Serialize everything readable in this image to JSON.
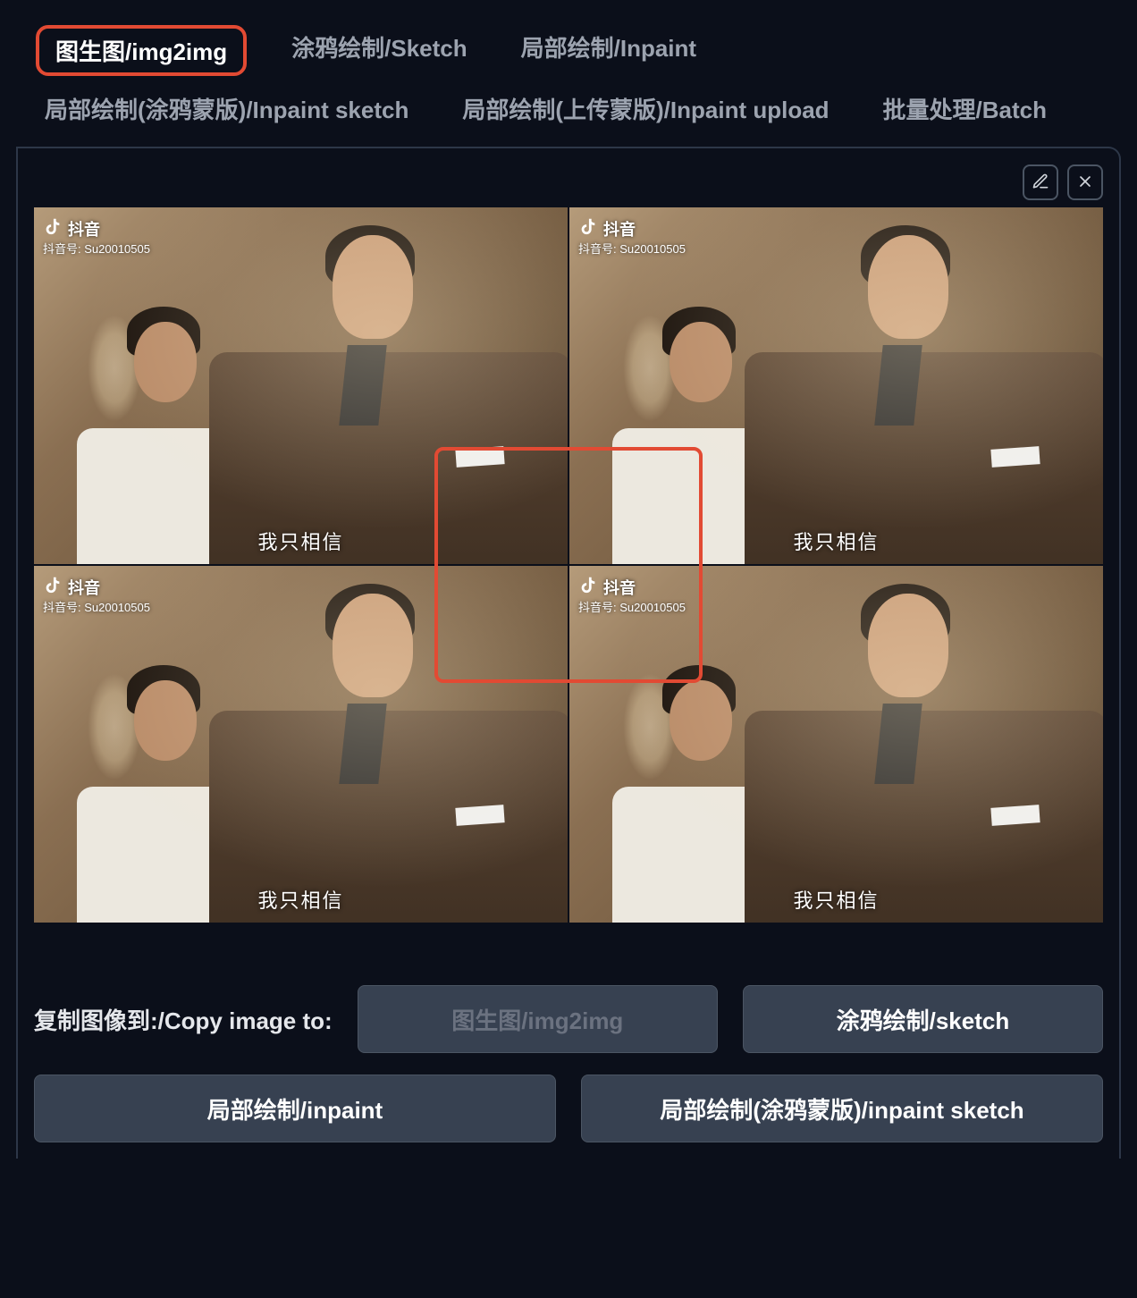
{
  "tabs": {
    "img2img": "图生图/img2img",
    "sketch": "涂鸦绘制/Sketch",
    "inpaint": "局部绘制/Inpaint",
    "inpaint_sketch": "局部绘制(涂鸦蒙版)/Inpaint sketch",
    "inpaint_upload": "局部绘制(上传蒙版)/Inpaint upload",
    "batch": "批量处理/Batch"
  },
  "image_grid": {
    "watermark": {
      "brand": "抖音",
      "account_prefix": "抖音号: ",
      "account": "Su20010505"
    },
    "caption": "我只相信"
  },
  "copy_section": {
    "label": "复制图像到:/Copy image to:",
    "buttons": {
      "img2img": "图生图/img2img",
      "sketch": "涂鸦绘制/sketch",
      "inpaint": "局部绘制/inpaint",
      "inpaint_sketch": "局部绘制(涂鸦蒙版)/inpaint sketch"
    }
  },
  "highlight": {
    "tab_color": "#e24a33",
    "center_box_color": "#e24a33"
  }
}
